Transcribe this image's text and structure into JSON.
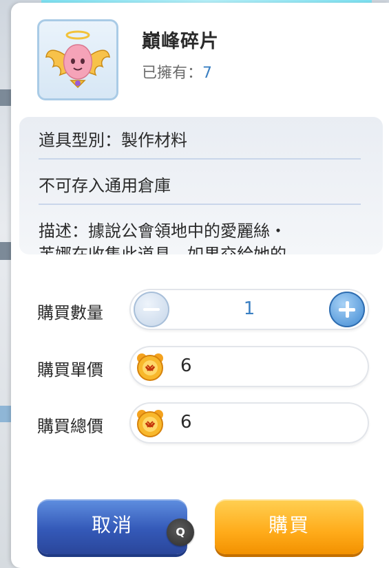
{
  "item": {
    "name": "巔峰碎片",
    "owned_label": "已擁有：",
    "owned_count": "7",
    "icon": "winged-pink-poring-icon"
  },
  "info": {
    "type_line": "道具型別：製作材料",
    "storage_line": "不可存入通用倉庫",
    "desc_line": "描述：據說公會領地中的愛麗絲・",
    "desc_cut_line": "芙娜在收集此道具，如果交給她的"
  },
  "purchase": {
    "qty_label": "購買數量",
    "qty_value": "1",
    "unit_label": "購買單價",
    "unit_value": "6",
    "total_label": "購買總價",
    "total_value": "6",
    "currency_icon": "bear-coin-icon"
  },
  "buttons": {
    "cancel": "取消",
    "buy": "購買",
    "hotkey": "Q"
  },
  "colors": {
    "accent_blue": "#3a7fc2",
    "cancel_blue": "#3459b8",
    "buy_orange": "#ffab1a"
  }
}
